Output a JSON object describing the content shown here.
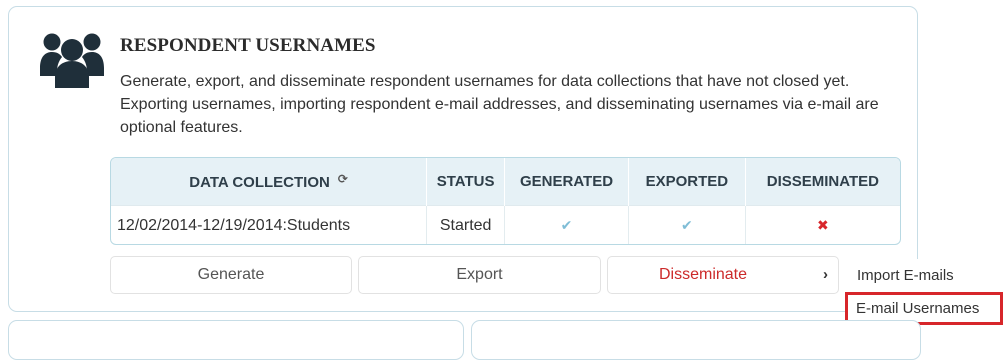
{
  "card": {
    "icon": "users-icon",
    "title": "RESPONDENT USERNAMES",
    "description": "Generate, export, and disseminate respondent usernames for data collections that have not closed yet. Exporting usernames, importing respondent e-mail addresses, and disseminating usernames via e-mail are optional features."
  },
  "table": {
    "headers": {
      "data_collection": "DATA COLLECTION",
      "status": "STATUS",
      "generated": "GENERATED",
      "exported": "EXPORTED",
      "disseminated": "DISSEMINATED"
    },
    "rows": [
      {
        "data_collection": "12/02/2014-12/19/2014:Students",
        "status": "Started",
        "generated": "✔",
        "exported": "✔",
        "disseminated": "✖"
      }
    ]
  },
  "buttons": {
    "generate": "Generate",
    "export": "Export",
    "disseminate": "Disseminate",
    "chevron": "›"
  },
  "submenu": {
    "import_emails": "Import E-mails",
    "email_usernames": "E-mail Usernames"
  },
  "colors": {
    "accent": "#cc2a2a",
    "check": "#7fbdd6",
    "cross": "#d8262b",
    "card_border": "#c7dde6",
    "header_bg": "#e6f1f6",
    "highlight": "#d7262a"
  }
}
